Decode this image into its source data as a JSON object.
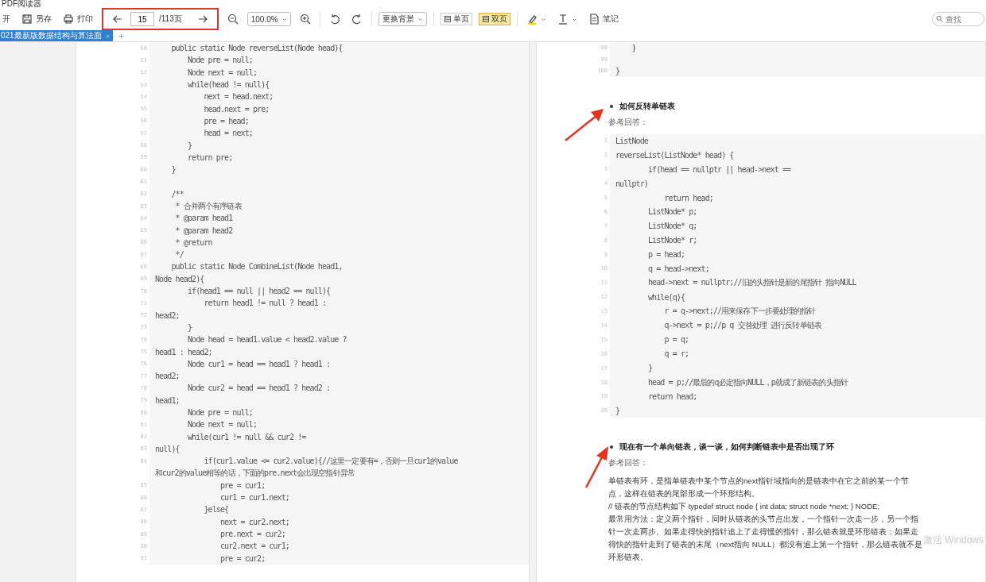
{
  "window": {
    "title": "PDF阅读器"
  },
  "toolbar": {
    "open": "开",
    "save": "另存",
    "print": "打印",
    "page_input": "15",
    "page_total": "/113页",
    "zoom": "100.0%",
    "background": "更换背景",
    "views": [
      {
        "label": "单页",
        "selected": false
      },
      {
        "label": "双页",
        "selected": true
      }
    ],
    "note": "笔记",
    "search": {
      "placeholder": "查找"
    }
  },
  "tabs": [
    {
      "label": "021最新版数据结构与算法面",
      "selected": true
    }
  ],
  "left_page": {
    "code_lines": [
      {
        "num": "50",
        "text": "    public static Node reverseList(Node head){"
      },
      {
        "num": "51",
        "text": "        Node pre = null;"
      },
      {
        "num": "52",
        "text": "        Node next = null;"
      },
      {
        "num": "53",
        "text": "        while(head != null){"
      },
      {
        "num": "54",
        "text": "            next = head.next;"
      },
      {
        "num": "55",
        "text": "            head.next = pre;"
      },
      {
        "num": "56",
        "text": "            pre = head;"
      },
      {
        "num": "57",
        "text": "            head = next;"
      },
      {
        "num": "58",
        "text": "        }"
      },
      {
        "num": "59",
        "text": "        return pre;"
      },
      {
        "num": "60",
        "text": "    }"
      },
      {
        "num": "61"
      },
      {
        "num": "62",
        "text": "    /**"
      },
      {
        "num": "63",
        "text": "     * 合并两个有序链表"
      },
      {
        "num": "64",
        "text": "     * @param head1"
      },
      {
        "num": "65",
        "text": "     * @param head2"
      },
      {
        "num": "66",
        "text": "     * @return"
      },
      {
        "num": "67",
        "text": "     */"
      },
      {
        "num": "68",
        "text": "    public static Node CombineList(Node head1,"
      },
      {
        "num": "69",
        "text": "Node head2){"
      },
      {
        "num": "70",
        "text": "        if(head1 == null || head2 == null){"
      },
      {
        "num": "71",
        "text": "            return head1 != null ? head1 :"
      },
      {
        "num": "72",
        "text": "head2;"
      },
      {
        "num": "73",
        "text": "        }"
      },
      {
        "num": "74",
        "text": "        Node head = head1.value < head2.value ?"
      },
      {
        "num": "75",
        "text": "head1 : head2;"
      },
      {
        "num": "76",
        "text": "        Node cur1 = head == head1 ? head1 :"
      },
      {
        "num": "77",
        "text": "head2;"
      },
      {
        "num": "78",
        "text": "        Node cur2 = head == head1 ? head2 :"
      },
      {
        "num": "79",
        "text": "head1;"
      },
      {
        "num": "80",
        "text": "        Node pre = null;"
      },
      {
        "num": "81",
        "text": "        Node next = null;"
      },
      {
        "num": "82",
        "text": "        while(cur1 != null && cur2 !="
      },
      {
        "num": "83",
        "text": "null){"
      },
      {
        "num": "84",
        "text": "            if(cur1.value <= cur2.value){//这里一定要有=，否则一旦cur1的value"
      },
      {
        "text": "和cur2的value相等的话，下面的pre.next会出现空指针异常"
      },
      {
        "num": "85",
        "text": "                pre = cur1;"
      },
      {
        "num": "86",
        "text": "                cur1 = cur1.next;"
      },
      {
        "num": "87",
        "text": "            }else{"
      },
      {
        "num": "88",
        "text": "                next = cur2.next;"
      },
      {
        "num": "89",
        "text": "                pre.next = cur2;"
      },
      {
        "num": "90",
        "text": "                cur2.next = cur1;"
      },
      {
        "num": "91",
        "text": "                pre = cur2;"
      }
    ]
  },
  "right_page": {
    "top_code_lines": [
      {
        "num": "98",
        "text": "    }"
      },
      {
        "num": "99"
      },
      {
        "num": "100",
        "text": "}"
      }
    ],
    "sections": [
      {
        "heading": "如何反转单链表",
        "label": "参考回答：",
        "code_lines": [
          {
            "num": "1",
            "text": "ListNode"
          },
          {
            "num": "2",
            "text": "reverseList(ListNode* head) {"
          },
          {
            "num": "3",
            "text": "        if(head == nullptr || head->next =="
          },
          {
            "num": "4",
            "text": "nullptr)"
          },
          {
            "num": "5",
            "text": "            return head;"
          },
          {
            "num": "6",
            "text": "        ListNode* p;"
          },
          {
            "num": "7",
            "text": "        ListNode* q;"
          },
          {
            "num": "8",
            "text": "        ListNode* r;"
          },
          {
            "num": "9",
            "text": "        p = head;"
          },
          {
            "num": "10",
            "text": "        q = head->next;"
          },
          {
            "num": "11",
            "text": "        head->next = nullptr;//旧的头指针是新的尾指针 指向NULL"
          },
          {
            "num": "12",
            "text": "        while(q){"
          },
          {
            "num": "13",
            "text": "            r = q->next;//用来保存下一步要处理的指针"
          },
          {
            "num": "14",
            "text": "            q->next = p;//p q 交替处理 进行反转单链表"
          },
          {
            "num": "15",
            "text": "            p = q;"
          },
          {
            "num": "16",
            "text": "            q = r;"
          },
          {
            "num": "17",
            "text": "        }"
          },
          {
            "num": "18",
            "text": "        head = p;//最后的q必定指向NULL，p就成了新链表的头指针"
          },
          {
            "num": "19",
            "text": "        return head;"
          },
          {
            "num": "20",
            "text": "}"
          }
        ]
      },
      {
        "heading": "现在有一个单向链表，谈一谈，如何判断链表中是否出现了环",
        "label": "参考回答：",
        "paragraphs": [
          "单链表有环，是指单链表中某个节点的next指针域指向的是链表中在它之前的某一个节点，这样在链表的尾部形成一个环形结构。",
          "// 链表的节点结构如下 typedef struct node { int data; struct node *next; } NODE;",
          "最常用方法：定义两个指针，同时从链表的头节点出发，一个指针一次走一步，另一个指针一次走两步。如果走得快的指针追上了走得慢的指针，那么链表就是环形链表；如果走得快的指针走到了链表的末尾（next指向 NULL）都没有追上第一个指针，那么链表就不是环形链表。"
        ]
      }
    ]
  },
  "os_notice": "激活 Windows"
}
